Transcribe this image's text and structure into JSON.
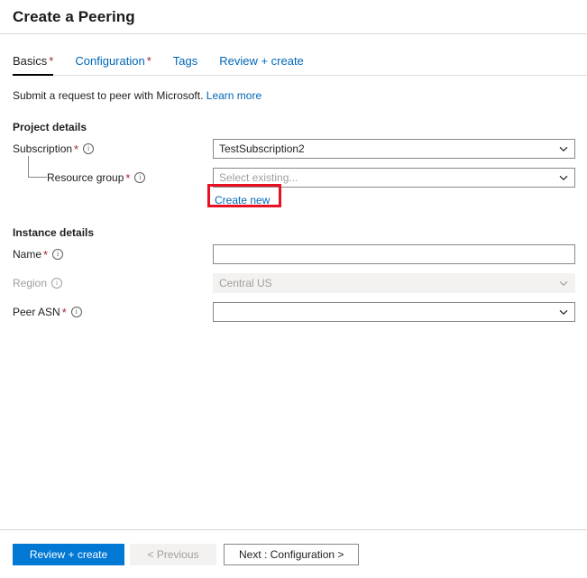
{
  "header": {
    "title": "Create a Peering"
  },
  "tabs": [
    {
      "label": "Basics",
      "required": true,
      "active": true
    },
    {
      "label": "Configuration",
      "required": true,
      "active": false
    },
    {
      "label": "Tags",
      "required": false,
      "active": false
    },
    {
      "label": "Review + create",
      "required": false,
      "active": false
    }
  ],
  "intro": {
    "text": "Submit a request to peer with Microsoft.",
    "link_label": "Learn more"
  },
  "project_details": {
    "section_title": "Project details",
    "subscription": {
      "label": "Subscription",
      "required_marker": "*",
      "info_icon": "info-icon",
      "value": "TestSubscription2",
      "chevron_icon": "chevron-down-icon"
    },
    "resource_group": {
      "label": "Resource group",
      "required_marker": "*",
      "info_icon": "info-icon",
      "value": "",
      "placeholder": "Select existing...",
      "chevron_icon": "chevron-down-icon",
      "create_new_label": "Create new"
    }
  },
  "instance_details": {
    "section_title": "Instance details",
    "name": {
      "label": "Name",
      "required_marker": "*",
      "info_icon": "info-icon",
      "value": "",
      "placeholder": ""
    },
    "region": {
      "label": "Region",
      "required_marker": "",
      "info_icon": "info-icon",
      "value": "Central US",
      "disabled": true,
      "chevron_icon": "chevron-down-icon"
    },
    "peer_asn": {
      "label": "Peer ASN",
      "required_marker": "*",
      "info_icon": "info-icon",
      "value": "",
      "placeholder": "",
      "chevron_icon": "chevron-down-icon"
    }
  },
  "footer": {
    "review_create_label": "Review + create",
    "previous_label": "< Previous",
    "next_label": "Next : Configuration >"
  },
  "annotation": {
    "target": "create-new-link",
    "color": "#e81123"
  },
  "colors": {
    "accent": "#0078d4",
    "link": "#0067b8",
    "required": "#a4262c",
    "disabled_bg": "#f3f2f1",
    "disabled_text": "#a19f9d",
    "border": "#8a8886",
    "highlight": "#e81123"
  }
}
